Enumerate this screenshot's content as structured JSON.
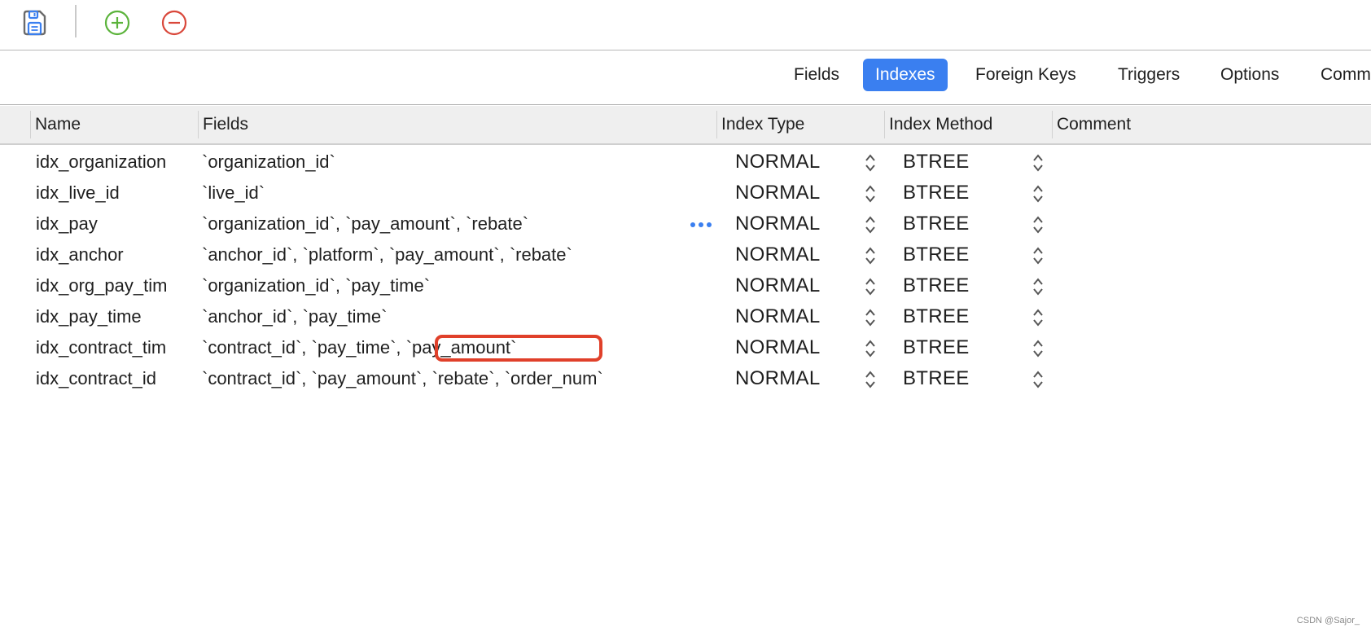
{
  "toolbar": {
    "buttons": [
      {
        "name": "save",
        "icon": "save-icon"
      },
      {
        "name": "add",
        "icon": "plus-circle-icon",
        "color": "#5bb33b"
      },
      {
        "name": "remove",
        "icon": "minus-circle-icon",
        "color": "#d9473a"
      }
    ]
  },
  "tabs": [
    {
      "label": "Fields",
      "active": false
    },
    {
      "label": "Indexes",
      "active": true
    },
    {
      "label": "Foreign Keys",
      "active": false
    },
    {
      "label": "Triggers",
      "active": false
    },
    {
      "label": "Options",
      "active": false
    },
    {
      "label": "Comm",
      "active": false
    }
  ],
  "accent_color": "#3a7ff0",
  "table": {
    "columns": [
      "Name",
      "Fields",
      "Index Type",
      "Index Method",
      "Comment"
    ],
    "rows": [
      {
        "name": "idx_organization",
        "fields": "`organization_id`",
        "index_type": "NORMAL",
        "index_method": "BTREE",
        "comment": ""
      },
      {
        "name": "idx_live_id",
        "fields": "`live_id`",
        "index_type": "NORMAL",
        "index_method": "BTREE",
        "comment": ""
      },
      {
        "name": "idx_pay",
        "fields": "`organization_id`, `pay_amount`, `rebate`",
        "index_type": "NORMAL",
        "index_method": "BTREE",
        "comment": "",
        "has_more_button": true
      },
      {
        "name": "idx_anchor",
        "fields": "`anchor_id`, `platform`, `pay_amount`, `rebate`",
        "index_type": "NORMAL",
        "index_method": "BTREE",
        "comment": ""
      },
      {
        "name": "idx_org_pay_tim",
        "fields": "`organization_id`, `pay_time`",
        "index_type": "NORMAL",
        "index_method": "BTREE",
        "comment": ""
      },
      {
        "name": "idx_pay_time",
        "fields": "`anchor_id`, `pay_time`",
        "index_type": "NORMAL",
        "index_method": "BTREE",
        "comment": ""
      },
      {
        "name": "idx_contract_tim",
        "fields": "`contract_id`, `pay_time`, `pay_amount`",
        "index_type": "NORMAL",
        "index_method": "BTREE",
        "comment": "",
        "highlighted_field": "`pay_amount`"
      },
      {
        "name": "idx_contract_id",
        "fields": "`contract_id`, `pay_amount`, `rebate`, `order_num`",
        "index_type": "NORMAL",
        "index_method": "BTREE",
        "comment": ""
      }
    ]
  },
  "annotation": {
    "highlight_color": "#e0402a"
  },
  "watermark": "CSDN @Sajor_"
}
